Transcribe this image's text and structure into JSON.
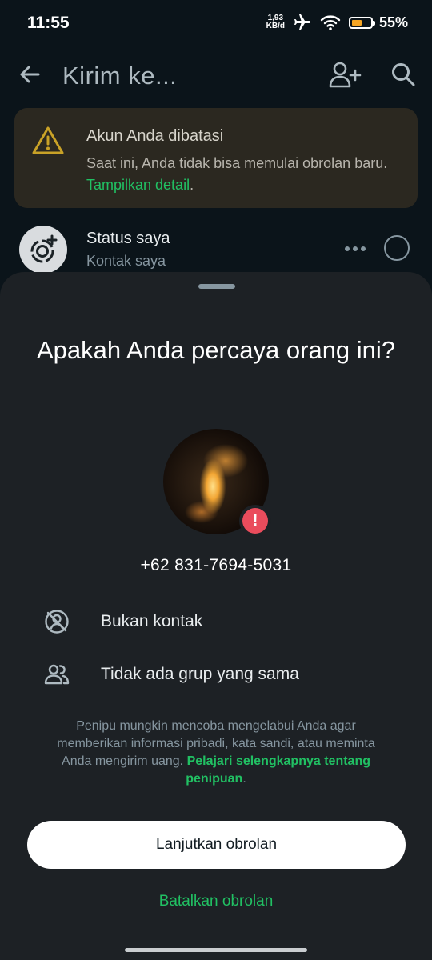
{
  "status_bar": {
    "time": "11:55",
    "net_speed_value": "1,93",
    "net_speed_unit": "KB/d",
    "battery_percent_label": "55%",
    "battery_level": 0.55,
    "icons": [
      "airplane-icon",
      "wifi-icon",
      "battery-icon"
    ]
  },
  "app_bar": {
    "title": "Kirim ke...",
    "icons": [
      "back-arrow-icon",
      "add-contact-icon",
      "search-icon"
    ]
  },
  "restriction_banner": {
    "title": "Akun Anda dibatasi",
    "body": "Saat ini, Anda tidak bisa memulai obrolan baru.",
    "link": "Tampilkan detail",
    "link_suffix": ".",
    "accent_color": "#c9a227"
  },
  "status_item": {
    "name": "Status saya",
    "subtitle": "Kontak saya"
  },
  "sheet": {
    "title": "Apakah Anda percaya orang ini?",
    "phone": "+62 831-7694-5031",
    "alert_glyph": "!",
    "info_rows": [
      {
        "icon": "not-contact-icon",
        "label": "Bukan kontak"
      },
      {
        "icon": "group-icon",
        "label": "Tidak ada grup yang sama"
      }
    ],
    "disclaimer_text": "Penipu mungkin mencoba mengelabui Anda agar memberikan informasi pribadi, kata sandi, atau meminta Anda mengirim uang.",
    "disclaimer_link": "Pelajari selengkapnya tentang penipuan",
    "disclaimer_suffix": ".",
    "primary_button": "Lanjutkan obrolan",
    "secondary_button": "Batalkan obrolan"
  },
  "colors": {
    "background": "#0b141a",
    "sheet": "#1d2125",
    "accent_green": "#21c063",
    "alert_red": "#ea4c5c"
  }
}
